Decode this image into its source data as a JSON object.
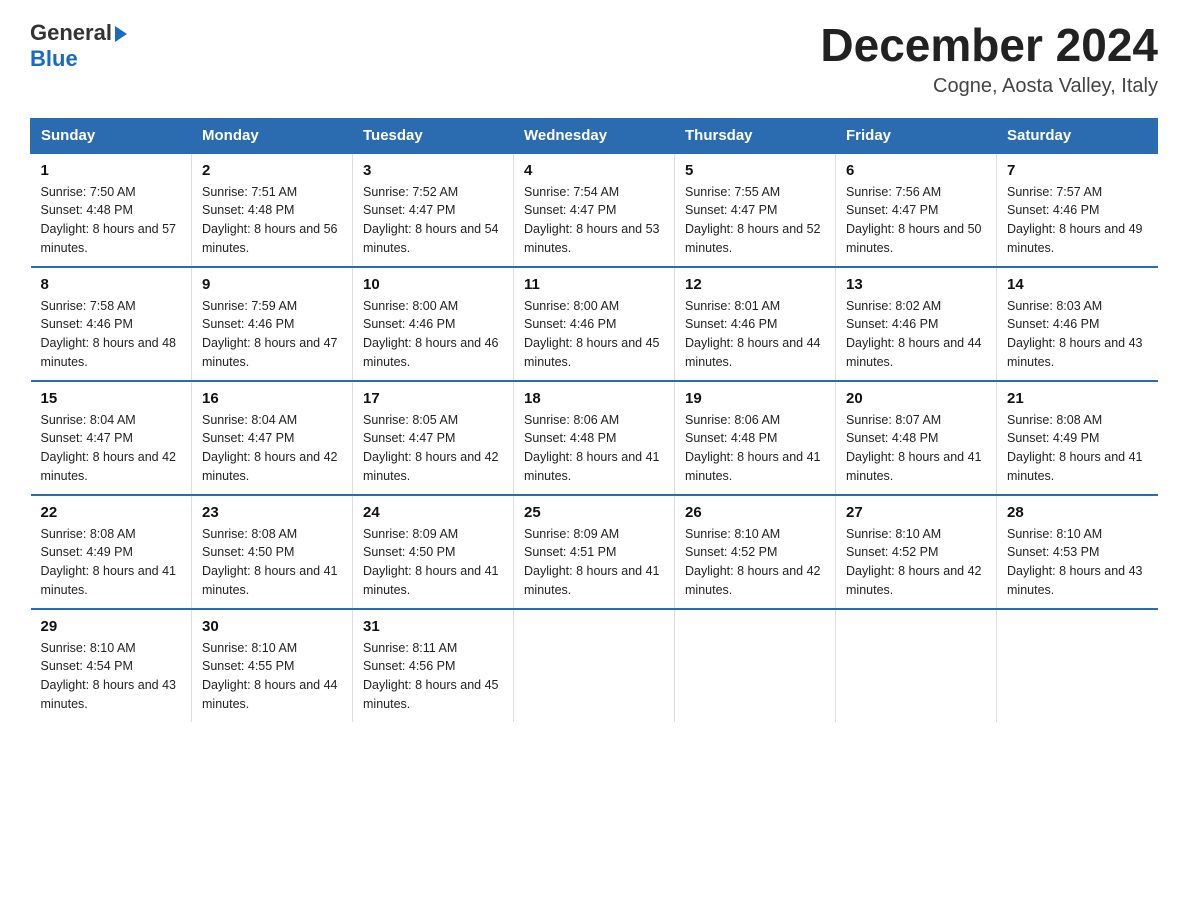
{
  "logo": {
    "general": "General",
    "blue": "Blue",
    "arrow": "▶"
  },
  "title": "December 2024",
  "location": "Cogne, Aosta Valley, Italy",
  "days_of_week": [
    "Sunday",
    "Monday",
    "Tuesday",
    "Wednesday",
    "Thursday",
    "Friday",
    "Saturday"
  ],
  "weeks": [
    [
      {
        "day": "1",
        "sunrise": "7:50 AM",
        "sunset": "4:48 PM",
        "daylight": "8 hours and 57 minutes."
      },
      {
        "day": "2",
        "sunrise": "7:51 AM",
        "sunset": "4:48 PM",
        "daylight": "8 hours and 56 minutes."
      },
      {
        "day": "3",
        "sunrise": "7:52 AM",
        "sunset": "4:47 PM",
        "daylight": "8 hours and 54 minutes."
      },
      {
        "day": "4",
        "sunrise": "7:54 AM",
        "sunset": "4:47 PM",
        "daylight": "8 hours and 53 minutes."
      },
      {
        "day": "5",
        "sunrise": "7:55 AM",
        "sunset": "4:47 PM",
        "daylight": "8 hours and 52 minutes."
      },
      {
        "day": "6",
        "sunrise": "7:56 AM",
        "sunset": "4:47 PM",
        "daylight": "8 hours and 50 minutes."
      },
      {
        "day": "7",
        "sunrise": "7:57 AM",
        "sunset": "4:46 PM",
        "daylight": "8 hours and 49 minutes."
      }
    ],
    [
      {
        "day": "8",
        "sunrise": "7:58 AM",
        "sunset": "4:46 PM",
        "daylight": "8 hours and 48 minutes."
      },
      {
        "day": "9",
        "sunrise": "7:59 AM",
        "sunset": "4:46 PM",
        "daylight": "8 hours and 47 minutes."
      },
      {
        "day": "10",
        "sunrise": "8:00 AM",
        "sunset": "4:46 PM",
        "daylight": "8 hours and 46 minutes."
      },
      {
        "day": "11",
        "sunrise": "8:00 AM",
        "sunset": "4:46 PM",
        "daylight": "8 hours and 45 minutes."
      },
      {
        "day": "12",
        "sunrise": "8:01 AM",
        "sunset": "4:46 PM",
        "daylight": "8 hours and 44 minutes."
      },
      {
        "day": "13",
        "sunrise": "8:02 AM",
        "sunset": "4:46 PM",
        "daylight": "8 hours and 44 minutes."
      },
      {
        "day": "14",
        "sunrise": "8:03 AM",
        "sunset": "4:46 PM",
        "daylight": "8 hours and 43 minutes."
      }
    ],
    [
      {
        "day": "15",
        "sunrise": "8:04 AM",
        "sunset": "4:47 PM",
        "daylight": "8 hours and 42 minutes."
      },
      {
        "day": "16",
        "sunrise": "8:04 AM",
        "sunset": "4:47 PM",
        "daylight": "8 hours and 42 minutes."
      },
      {
        "day": "17",
        "sunrise": "8:05 AM",
        "sunset": "4:47 PM",
        "daylight": "8 hours and 42 minutes."
      },
      {
        "day": "18",
        "sunrise": "8:06 AM",
        "sunset": "4:48 PM",
        "daylight": "8 hours and 41 minutes."
      },
      {
        "day": "19",
        "sunrise": "8:06 AM",
        "sunset": "4:48 PM",
        "daylight": "8 hours and 41 minutes."
      },
      {
        "day": "20",
        "sunrise": "8:07 AM",
        "sunset": "4:48 PM",
        "daylight": "8 hours and 41 minutes."
      },
      {
        "day": "21",
        "sunrise": "8:08 AM",
        "sunset": "4:49 PM",
        "daylight": "8 hours and 41 minutes."
      }
    ],
    [
      {
        "day": "22",
        "sunrise": "8:08 AM",
        "sunset": "4:49 PM",
        "daylight": "8 hours and 41 minutes."
      },
      {
        "day": "23",
        "sunrise": "8:08 AM",
        "sunset": "4:50 PM",
        "daylight": "8 hours and 41 minutes."
      },
      {
        "day": "24",
        "sunrise": "8:09 AM",
        "sunset": "4:50 PM",
        "daylight": "8 hours and 41 minutes."
      },
      {
        "day": "25",
        "sunrise": "8:09 AM",
        "sunset": "4:51 PM",
        "daylight": "8 hours and 41 minutes."
      },
      {
        "day": "26",
        "sunrise": "8:10 AM",
        "sunset": "4:52 PM",
        "daylight": "8 hours and 42 minutes."
      },
      {
        "day": "27",
        "sunrise": "8:10 AM",
        "sunset": "4:52 PM",
        "daylight": "8 hours and 42 minutes."
      },
      {
        "day": "28",
        "sunrise": "8:10 AM",
        "sunset": "4:53 PM",
        "daylight": "8 hours and 43 minutes."
      }
    ],
    [
      {
        "day": "29",
        "sunrise": "8:10 AM",
        "sunset": "4:54 PM",
        "daylight": "8 hours and 43 minutes."
      },
      {
        "day": "30",
        "sunrise": "8:10 AM",
        "sunset": "4:55 PM",
        "daylight": "8 hours and 44 minutes."
      },
      {
        "day": "31",
        "sunrise": "8:11 AM",
        "sunset": "4:56 PM",
        "daylight": "8 hours and 45 minutes."
      },
      null,
      null,
      null,
      null
    ]
  ]
}
